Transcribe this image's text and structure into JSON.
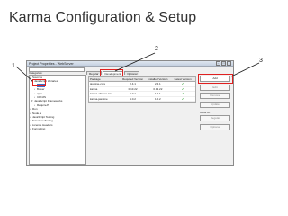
{
  "slide": {
    "title": "Karma Configuration & Setup"
  },
  "callouts": {
    "c1": "1",
    "c2": "2",
    "c3": "3"
  },
  "dialog": {
    "title": "Project Properties - WebServer",
    "filter": "",
    "categories_label": "Categories:",
    "tree": [
      {
        "label": "Sources",
        "level": 0
      },
      {
        "label": "JavaScript Libraries",
        "level": 1
      },
      {
        "label": "Karma",
        "level": 2
      },
      {
        "label": "Bower",
        "level": 2
      },
      {
        "label": "npm",
        "level": 2
      },
      {
        "label": "CDNJS",
        "level": 2
      },
      {
        "label": "JavaScript Frameworks",
        "level": 1
      },
      {
        "label": "RequireJS",
        "level": 2
      },
      {
        "label": "Run",
        "level": 0
      },
      {
        "label": "Node.js",
        "level": 0
      },
      {
        "label": "JavaScript Testing",
        "level": 0
      },
      {
        "label": "Selenium Testing",
        "level": 0
      },
      {
        "label": "License Headers",
        "level": 0
      },
      {
        "label": "Formatting",
        "level": 0
      }
    ],
    "tabs": [
      "Regular",
      "Development",
      "Optional"
    ],
    "table": {
      "headers": [
        "Package",
        "Required Version",
        "Installed Version",
        "Latest Version"
      ],
      "rows": [
        [
          "jasmine-core",
          "2.4.1",
          "2.4.1",
          "✔"
        ],
        [
          "karma",
          "0.13.22",
          "0.13.22",
          "✔"
        ],
        [
          "karma-chrome-lau...",
          "1.0.1",
          "1.0.1",
          "✔"
        ],
        [
          "karma-jasmine",
          "1.0.2",
          "1.0.2",
          "✔"
        ]
      ]
    },
    "buttons": {
      "add": "Add",
      "edit": "Edit",
      "remove": "Remove",
      "update": "Update",
      "move_to": "Move to:",
      "regular": "Regular",
      "optional": "Optional"
    },
    "window_controls": {
      "minimize": "–",
      "maximize": "□",
      "close": "×"
    },
    "highlight_color": "#e02020"
  }
}
